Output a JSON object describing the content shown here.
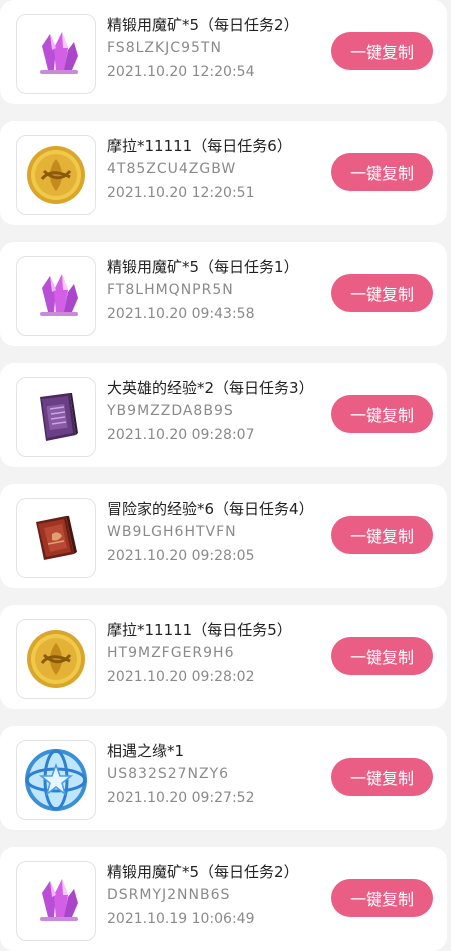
{
  "items": [
    {
      "title": "精锻用魔矿*5（每日任务2）",
      "code": "FS8LZKJC95TN",
      "time": "2021.10.20 12:20:54",
      "icon": "crystal-icon",
      "button": "一键复制"
    },
    {
      "title": "摩拉*11111（每日任务6）",
      "code": "4T85ZCU4ZGBW",
      "time": "2021.10.20 12:20:51",
      "icon": "mora-coin-icon",
      "button": "一键复制"
    },
    {
      "title": "精锻用魔矿*5（每日任务1）",
      "code": "FT8LHMQNPR5N",
      "time": "2021.10.20 09:43:58",
      "icon": "crystal-icon",
      "button": "一键复制"
    },
    {
      "title": "大英雄的经验*2（每日任务3）",
      "code": "YB9MZZDA8B9S",
      "time": "2021.10.20 09:28:07",
      "icon": "hero-wit-book-icon",
      "button": "一键复制"
    },
    {
      "title": "冒险家的经验*6（每日任务4）",
      "code": "WB9LGH6HTVFN",
      "time": "2021.10.20 09:28:05",
      "icon": "adventurer-exp-book-icon",
      "button": "一键复制"
    },
    {
      "title": "摩拉*11111（每日任务5）",
      "code": "HT9MZFGER9H6",
      "time": "2021.10.20 09:28:02",
      "icon": "mora-coin-icon",
      "button": "一键复制"
    },
    {
      "title": "相遇之缘*1",
      "code": "US832S27NZY6",
      "time": "2021.10.20 09:27:52",
      "icon": "acquaint-fate-icon",
      "button": "一键复制"
    },
    {
      "title": "精锻用魔矿*5（每日任务2）",
      "code": "DSRMYJ2NNB6S",
      "time": "2021.10.19 10:06:49",
      "icon": "crystal-icon",
      "button": "一键复制"
    }
  ],
  "colors": {
    "button": "#ea5e86",
    "background": "#f3f3f3"
  }
}
